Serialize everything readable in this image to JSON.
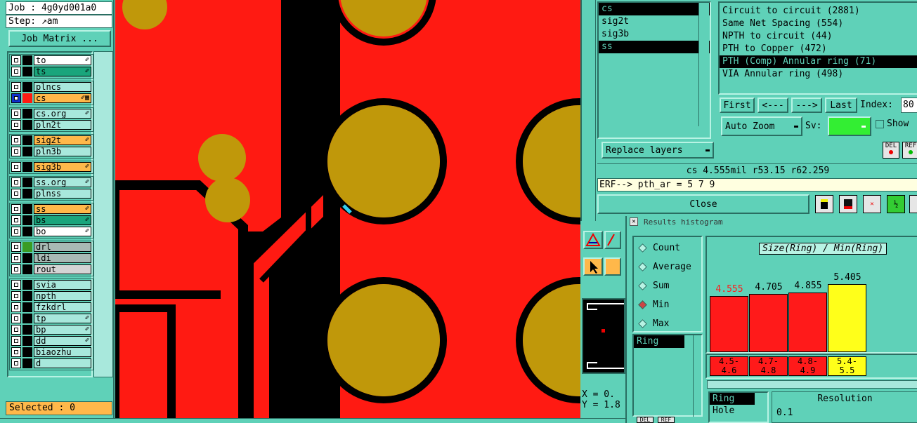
{
  "left": {
    "job_label": "Job : 4g0yd001a0",
    "step_label": "Step: ",
    "step_value": "am",
    "job_matrix": "Job Matrix ...",
    "selected": "Selected : 0",
    "layers": [
      {
        "name": "to",
        "style": "white",
        "flag": "✐"
      },
      {
        "name": "ts",
        "style": "green",
        "flag": "✐"
      },
      {
        "name": "plncs",
        "style": "plain",
        "flag": ""
      },
      {
        "name": "cs",
        "style": "orange",
        "flag": "✐▦",
        "active": true
      },
      {
        "name": "cs.org",
        "style": "plain",
        "flag": "✐"
      },
      {
        "name": "pln2t",
        "style": "plain",
        "flag": ""
      },
      {
        "name": "sig2t",
        "style": "orange",
        "flag": "✐"
      },
      {
        "name": "pln3b",
        "style": "plain",
        "flag": ""
      },
      {
        "name": "sig3b",
        "style": "orange",
        "flag": "✐"
      },
      {
        "name": "ss.org",
        "style": "plain",
        "flag": "✐"
      },
      {
        "name": "plnss",
        "style": "plain",
        "flag": ""
      },
      {
        "name": "ss",
        "style": "orange",
        "flag": "✐"
      },
      {
        "name": "bs",
        "style": "green",
        "flag": "✐"
      },
      {
        "name": "bo",
        "style": "white",
        "flag": "✐"
      },
      {
        "name": "drl",
        "style": "grey",
        "flag": "",
        "green_sq": true
      },
      {
        "name": "ldi",
        "style": "grey",
        "flag": ""
      },
      {
        "name": "rout",
        "style": "lightgrey",
        "flag": ""
      },
      {
        "name": "svia",
        "style": "plain",
        "flag": ""
      },
      {
        "name": "npth",
        "style": "plain",
        "flag": ""
      },
      {
        "name": "fzkdrl",
        "style": "plain",
        "flag": ""
      },
      {
        "name": "tp",
        "style": "plain",
        "flag": "✐"
      },
      {
        "name": "bp",
        "style": "plain",
        "flag": "✐"
      },
      {
        "name": "dd",
        "style": "plain",
        "flag": "✐"
      },
      {
        "name": "biaozhu",
        "style": "plain",
        "flag": ""
      },
      {
        "name": "d",
        "style": "plain",
        "flag": ""
      }
    ]
  },
  "dialog": {
    "layers": [
      "cs",
      "sig2t",
      "sig3b",
      "ss"
    ],
    "replace_layers": "Replace layers",
    "checks": [
      "Circuit to circuit (2881)",
      "Same Net Spacing (554)",
      "NPTH to circuit (44)",
      "PTH to Copper (472)",
      "PTH (Comp) Annular ring (71)",
      "VIA Annular ring (498)"
    ],
    "nav": {
      "first": "First",
      "prev": "<---",
      "next": "--->",
      "last": "Last",
      "index_label": "Index:",
      "index_value": "80"
    },
    "auto_zoom": "Auto Zoom",
    "sv_label": "Sv:",
    "show_label": "Show",
    "del_label": "DEL",
    "ref_label": "REF",
    "status_line": "cs 4.555mil  r53.15  r62.259",
    "erf_line": "ERF--> pth_ar = 5 7 9",
    "close": "Close"
  },
  "histogram": {
    "window_title": "Results histogram",
    "modes": [
      {
        "label": "Count",
        "on": false
      },
      {
        "label": "Average",
        "on": false
      },
      {
        "label": "Sum",
        "on": false
      },
      {
        "label": "Min",
        "on": true
      },
      {
        "label": "Max",
        "on": false
      }
    ],
    "attr_list": [
      "Ring"
    ],
    "title": "Size(Ring) / Min(Ring)",
    "bars": [
      {
        "value": "4.555",
        "height": 0.73,
        "color": "#ff1a1a",
        "label_color": "#ff1a1a",
        "bin": "4.5-\n4.6"
      },
      {
        "value": "4.705",
        "height": 0.75,
        "color": "#ff1a1a",
        "label_color": "#000000",
        "bin": "4.7-\n4.8"
      },
      {
        "value": "4.855",
        "height": 0.77,
        "color": "#ff1a1a",
        "label_color": "#000000",
        "bin": "4.8-\n4.9"
      },
      {
        "value": "5.405",
        "height": 0.88,
        "color": "#ffff1a",
        "label_color": "#000000",
        "bin": "5.4-\n5.5"
      }
    ],
    "bottom_list": [
      "Ring",
      "Hole"
    ],
    "resolution_label": "Resolution",
    "resolution_value": "0.1",
    "del_label": "DEL",
    "ref_label": "REF"
  },
  "coords": {
    "x": "X = 0.",
    "y": "Y = 1.8"
  }
}
